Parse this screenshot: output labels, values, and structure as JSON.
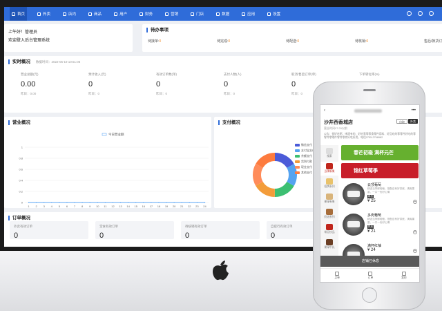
{
  "nav": {
    "items": [
      "首页",
      "外卖",
      "店内",
      "商品",
      "用户",
      "财务",
      "营销",
      "门店",
      "数据",
      "应用",
      "设置"
    ],
    "accent": "#2f6cd9"
  },
  "welcome": {
    "line1": "上午好！管理员",
    "line2": "欢迎登入后台管理系统"
  },
  "todo": {
    "title": "待办事项",
    "items": [
      {
        "label": "待接单:",
        "value": "0"
      },
      {
        "label": "待完成:",
        "value": "0"
      },
      {
        "label": "待配送:",
        "value": "0"
      },
      {
        "label": "待核销:",
        "value": "0"
      },
      {
        "label": "售后/换货订单:",
        "value": "0"
      }
    ]
  },
  "realtime": {
    "title": "实时概况",
    "time": "数据时间：2022-05-19 10:51:06",
    "metrics": [
      {
        "label": "营业总额(元)",
        "value": "0.00",
        "yesterday": "昨日：0.00"
      },
      {
        "label": "预计收入(元)",
        "value": "0",
        "yesterday": "昨日：0"
      },
      {
        "label": "有效订单数(单)",
        "value": "0",
        "yesterday": "昨日：0"
      },
      {
        "label": "支付人数(人)",
        "value": "0",
        "yesterday": "昨日：0"
      },
      {
        "label": "取消/售后订单(单)",
        "value": "0",
        "yesterday": "昨日：0"
      },
      {
        "label": "下单转化率(%)",
        "value": "",
        "yesterday": ""
      }
    ]
  },
  "sales_title": "营业概况",
  "pay_title": "支付概况",
  "pay_legend": [
    {
      "name": "微信支付",
      "color": "#4b5bd8"
    },
    {
      "name": "支付宝支付",
      "color": "#55a3f0"
    },
    {
      "name": "余额支付",
      "color": "#3cbf72"
    },
    {
      "name": "货到付款",
      "color": "#f39c3a"
    },
    {
      "name": "现金支付",
      "color": "#ff8c5a"
    },
    {
      "name": "其他支付",
      "color": "#fd7b3e"
    }
  ],
  "chart_data": {
    "type": "line",
    "series": [
      {
        "name": "今日营业额",
        "values": [
          0,
          0,
          0,
          0,
          0,
          0,
          0,
          0,
          0,
          0,
          0,
          0,
          0,
          0,
          0,
          0,
          0,
          0,
          0,
          0,
          0,
          0,
          0,
          0
        ]
      }
    ],
    "x": [
      "1",
      "2",
      "3",
      "4",
      "5",
      "6",
      "7",
      "8",
      "9",
      "10",
      "11",
      "12",
      "13",
      "14",
      "15",
      "16",
      "17",
      "18",
      "19",
      "20",
      "21",
      "22",
      "23",
      "24"
    ],
    "y_ticks": [
      "0",
      "0.2",
      "0.4",
      "0.6",
      "0.8",
      "1"
    ],
    "ylim": [
      0,
      1
    ],
    "legend": "top-center",
    "color": "#5aa5f5"
  },
  "orders": {
    "title": "订单概况",
    "cards": [
      {
        "label": "外卖有效订单",
        "value": "0"
      },
      {
        "label": "堂食有效订单",
        "value": "0"
      },
      {
        "label": "待核销有效订单",
        "value": "0"
      },
      {
        "label": "自提行有效订单",
        "value": "0"
      }
    ]
  },
  "phone": {
    "shop_name": "沙井西香城店",
    "shop_sub": "营业时间07:29以前",
    "shop_desc": "公告：餐好吃粥、啤酒有的、好吃零零零食零件用料、好品吃的零零件好吃的零零件零零件零件零件好吃好用，电话0755-2798982",
    "mode1": "自取",
    "mode2": "外卖",
    "categories": [
      {
        "label": "搜索",
        "color": "#dddddd"
      },
      {
        "label": "当季新果",
        "color": "#c0261c"
      },
      {
        "label": "招牌系列",
        "color": "#e9c26a"
      },
      {
        "label": "果绿有果",
        "color": "#d9b47a"
      },
      {
        "label": "奶油系列",
        "color": "#a76d3a"
      },
      {
        "label": "常见饮品",
        "color": "#c0261c"
      },
      {
        "label": "果绿牛乳",
        "color": "#6b3f25"
      }
    ],
    "banners": [
      {
        "text": "春芒初碰 满杯元芒",
        "color": "#66b02f"
      },
      {
        "text": "锦红草莓季",
        "color": "#c81e2a"
      }
    ],
    "products": [
      {
        "name": "云顶葡萄",
        "desc": "精选当季鲜葡萄，搭配自有好茶底，清爽果香，一口一份好心情",
        "tag": "新品",
        "price": "¥ 25"
      },
      {
        "name": "多肉葡萄",
        "desc": "精选当季鲜葡萄，搭配自有好茶底，清爽果香，一口一份好心情",
        "tag": "热卖",
        "price": "¥ 21"
      },
      {
        "name": "满杯红柚",
        "desc": "",
        "tag": "",
        "price": "¥ 24"
      }
    ],
    "closed_text": "店铺已休息",
    "tabs": [
      "点单",
      "订单",
      "我的"
    ]
  }
}
